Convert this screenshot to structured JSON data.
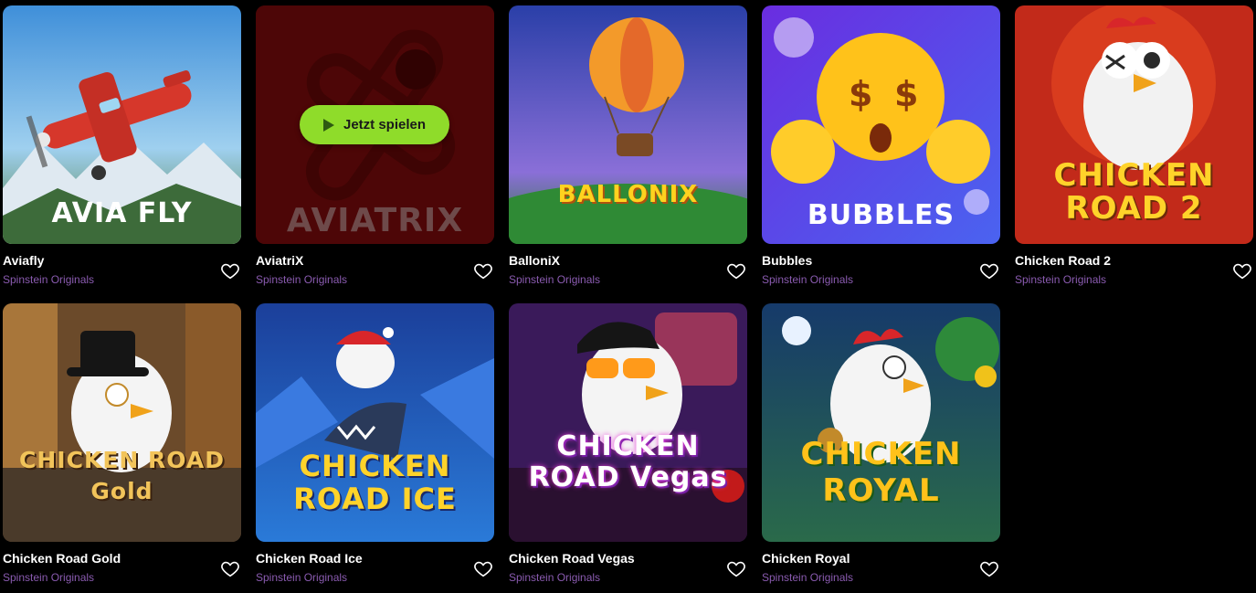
{
  "hover_action": {
    "label": "Jetzt spielen",
    "icon": "play-icon"
  },
  "favorite_icon": "heart-outline-icon",
  "colors": {
    "background": "#000000",
    "provider_text": "#8a5bb0",
    "play_button": "#8fdc2a"
  },
  "games": [
    {
      "name": "Aviafly",
      "provider": "Spinstein Originals",
      "art_title": "AVIA FLY"
    },
    {
      "name": "AviatriX",
      "provider": "Spinstein Originals",
      "art_title": "AVIATRIX"
    },
    {
      "name": "BalloniX",
      "provider": "Spinstein Originals",
      "art_title": "BALLONIX"
    },
    {
      "name": "Bubbles",
      "provider": "Spinstein Originals",
      "art_title": "BUBBLES"
    },
    {
      "name": "Chicken Road 2",
      "provider": "Spinstein Originals",
      "art_title": "CHICKEN ROAD 2"
    },
    {
      "name": "Chicken Road Gold",
      "provider": "Spinstein Originals",
      "art_title": "CHICKEN ROAD Gold"
    },
    {
      "name": "Chicken Road Ice",
      "provider": "Spinstein Originals",
      "art_title": "CHICKEN ROAD ICE"
    },
    {
      "name": "Chicken Road Vegas",
      "provider": "Spinstein Originals",
      "art_title": "CHICKEN ROAD Vegas"
    },
    {
      "name": "Chicken Royal",
      "provider": "Spinstein Originals",
      "art_title": "CHICKEN ROYAL"
    }
  ]
}
